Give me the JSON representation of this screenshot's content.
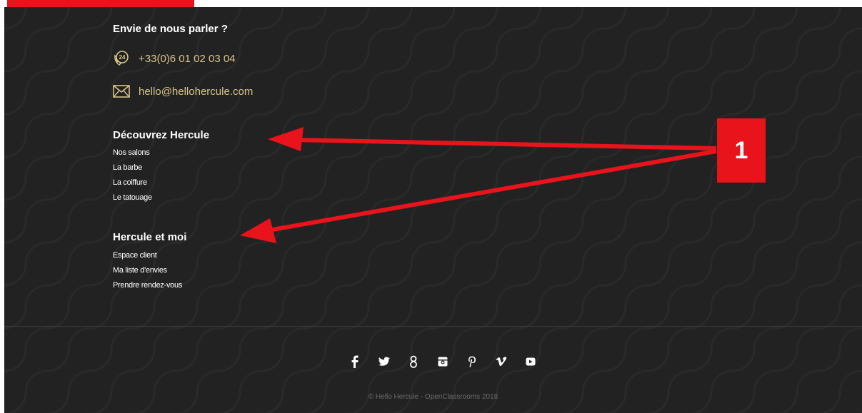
{
  "contact": {
    "title": "Envie de nous parler ?",
    "phone": "+33(0)6 01 02 03 04",
    "email": "hello@hellohercule.com",
    "phone_icon": "phone-24h-icon",
    "email_icon": "envelope-icon"
  },
  "sections": [
    {
      "title": "Découvrez Hercule",
      "links": [
        "Nos salons",
        "La barbe",
        "La coiffure",
        "Le tatouage"
      ]
    },
    {
      "title": "Hercule et moi",
      "links": [
        "Espace client",
        "Ma liste d'envies",
        "Prendre rendez-vous"
      ]
    }
  ],
  "social": [
    {
      "icon": "facebook-icon",
      "glyph": "f"
    },
    {
      "icon": "twitter-icon",
      "glyph": "✓"
    },
    {
      "icon": "google-plus-icon",
      "glyph": "g"
    },
    {
      "icon": "instagram-icon",
      "glyph": "◙"
    },
    {
      "icon": "pinterest-icon",
      "glyph": "p"
    },
    {
      "icon": "vimeo-icon",
      "glyph": "v"
    },
    {
      "icon": "youtube-icon",
      "glyph": "▶"
    }
  ],
  "copyright": "© Hello Hercule - OpenClassrooms 2018",
  "annotation": {
    "badge": "1"
  },
  "colors": {
    "background": "#222222",
    "accent_red": "#e8131b",
    "contact_gold": "#d8c48a"
  }
}
